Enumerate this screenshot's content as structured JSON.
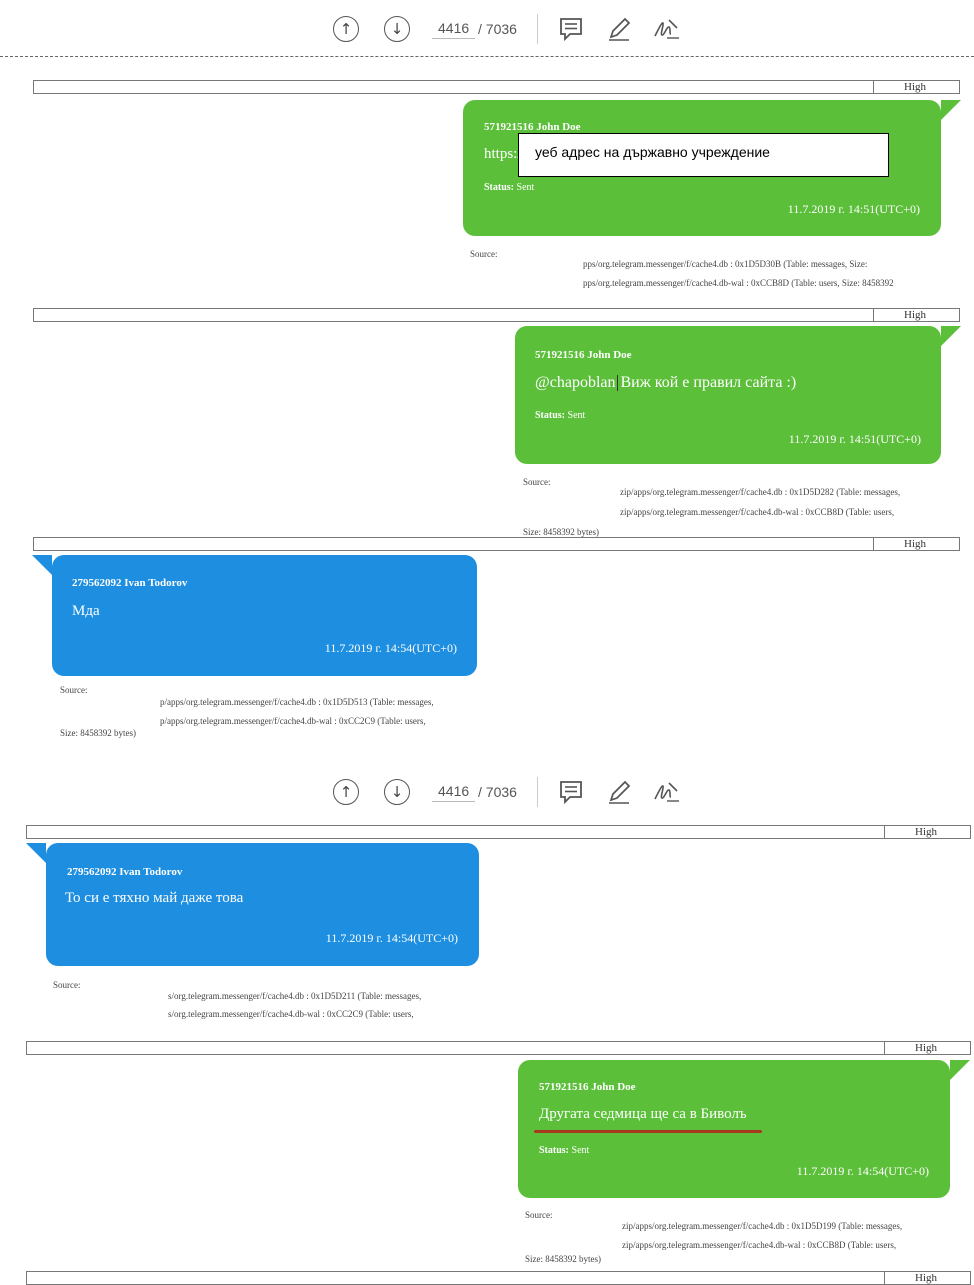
{
  "toolbar": {
    "page_current": "4416",
    "page_total": "/ 7036",
    "up_icon": "arrow-up-circle-icon",
    "down_icon": "arrow-down-circle-icon",
    "comment_icon": "comment-icon",
    "highlight_icon": "pen-icon",
    "sign_icon": "signature-icon"
  },
  "priority_label": "High",
  "messages": [
    {
      "sender": "571921516 John Doe",
      "text": "https:/",
      "redaction_note": "уеб адрес на държавно учреждение",
      "status_label": "Status:",
      "status_value": "Sent",
      "timestamp": "11.7.2019 г. 14:51(UTC+0)",
      "source_label": "Source:",
      "source_lines": [
        "pps/org.telegram.messenger/f/cache4.db : 0x1D5D30B (Table: messages, Size:",
        "pps/org.telegram.messenger/f/cache4.db-wal : 0xCCB8D (Table: users, Size: 8458392"
      ]
    },
    {
      "sender": "571921516 John Doe",
      "text_mention": "@chapoblan",
      "text_rest": "Виж кой е правил сайта :)",
      "status_label": "Status:",
      "status_value": "Sent",
      "timestamp": "11.7.2019 г. 14:51(UTC+0)",
      "source_label": "Source:",
      "source_lines": [
        "zip/apps/org.telegram.messenger/f/cache4.db : 0x1D5D282 (Table: messages,",
        "zip/apps/org.telegram.messenger/f/cache4.db-wal : 0xCCB8D (Table: users,",
        "Size: 8458392 bytes)"
      ]
    },
    {
      "sender": "279562092 Ivan Todorov",
      "text": "Мда",
      "timestamp": "11.7.2019 г. 14:54(UTC+0)",
      "source_label": "Source:",
      "source_lines": [
        "p/apps/org.telegram.messenger/f/cache4.db : 0x1D5D513 (Table: messages,",
        "p/apps/org.telegram.messenger/f/cache4.db-wal : 0xCC2C9 (Table: users,",
        "Size: 8458392 bytes)"
      ]
    },
    {
      "sender": "279562092 Ivan Todorov",
      "text": "То си е тяхно май даже това",
      "timestamp": "11.7.2019 г. 14:54(UTC+0)",
      "source_label": "Source:",
      "source_lines": [
        "s/org.telegram.messenger/f/cache4.db : 0x1D5D211 (Table: messages,",
        "s/org.telegram.messenger/f/cache4.db-wal : 0xCC2C9 (Table: users,"
      ]
    },
    {
      "sender": "571921516 John Doe",
      "text": "Другата седмица ще са в Биволъ",
      "status_label": "Status:",
      "status_value": "Sent",
      "timestamp": "11.7.2019 г. 14:54(UTC+0)",
      "source_label": "Source:",
      "source_lines": [
        "zip/apps/org.telegram.messenger/f/cache4.db : 0x1D5D199 (Table: messages,",
        "zip/apps/org.telegram.messenger/f/cache4.db-wal : 0xCCB8D (Table: users,",
        "Size: 8458392 bytes)"
      ]
    }
  ]
}
